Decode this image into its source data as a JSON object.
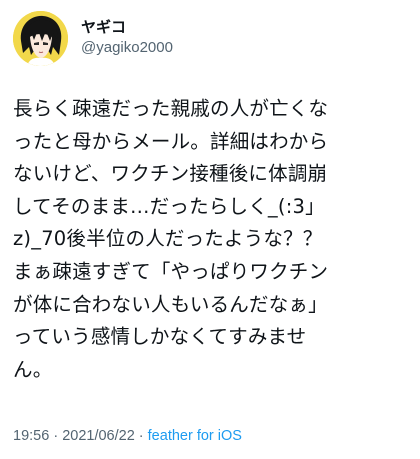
{
  "author": {
    "display_name": "ヤギコ",
    "handle": "@yagiko2000",
    "avatar": "anime-avatar-yellow-background"
  },
  "tweet": {
    "lines": [
      "長らく疎遠だった親戚の人が亡くな",
      "ったと母からメール。詳細はわから",
      "ないけど、ワクチン接種後に体調崩",
      "してそのまま…だったらしく_(:3」",
      "z)_70後半位の人だったような？？",
      "まぁ疎遠すぎて「やっぱりワクチン",
      "が体に合わない人もいるんだなぁ」",
      "っていう感情しかなくてすみませ",
      "ん。"
    ]
  },
  "meta": {
    "time": "19:56",
    "separator1": " · ",
    "date": "2021/06/22",
    "separator2": " · ",
    "source": "feather for iOS"
  },
  "colors": {
    "text": "#0f1419",
    "secondary": "#536471",
    "link": "#1d9bf0",
    "avatar_bg": "#f2d84a"
  }
}
